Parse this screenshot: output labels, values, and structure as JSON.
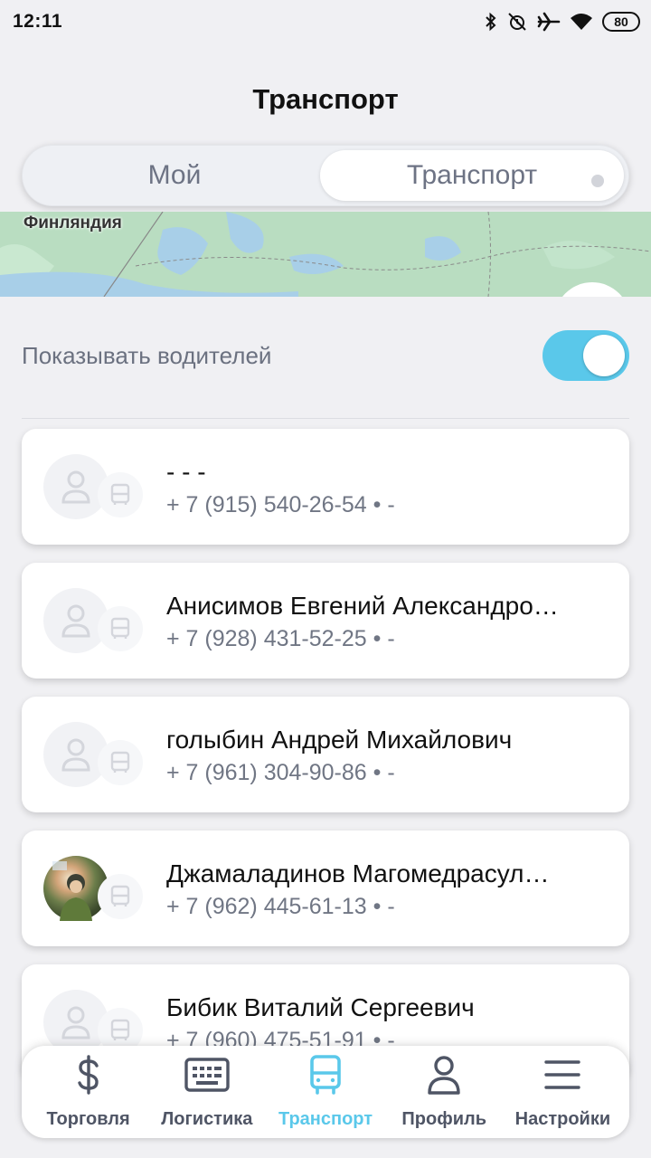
{
  "status_bar": {
    "time": "12:11",
    "battery": "80"
  },
  "header": {
    "title": "Транспорт"
  },
  "segmented": {
    "left_label": "Мой",
    "right_label": "Транспорт",
    "active": "right"
  },
  "map": {
    "label": "Финляндия"
  },
  "drivers_toggle": {
    "label": "Показывать водителей",
    "on": true
  },
  "vehicles": [
    {
      "name": "- - -",
      "phone": "+ 7 (915) 540-26-54 • -",
      "photo": false
    },
    {
      "name": "Анисимов Евгений Александро…",
      "phone": "+ 7 (928) 431-52-25 • -",
      "photo": false
    },
    {
      "name": "голыбин Андрей Михайлович",
      "phone": "+ 7 (961) 304-90-86 • -",
      "photo": false
    },
    {
      "name": "Джамаладинов Магомедрасул…",
      "phone": "+ 7 (962) 445-61-13 • -",
      "photo": true
    },
    {
      "name": "Бибик Виталий Сергеевич",
      "phone": "+ 7 (960) 475-51-91 • -",
      "photo": false
    }
  ],
  "bottom_nav": [
    {
      "label": "Торговля",
      "icon": "dollar-icon"
    },
    {
      "label": "Логистика",
      "icon": "keyboard-icon"
    },
    {
      "label": "Транспорт",
      "icon": "bus-icon",
      "active": true
    },
    {
      "label": "Профиль",
      "icon": "person-icon"
    },
    {
      "label": "Настройки",
      "icon": "menu-icon"
    }
  ],
  "colors": {
    "accent": "#5ac8ea",
    "text_muted": "#6b7180",
    "background": "#f0f0f3"
  }
}
